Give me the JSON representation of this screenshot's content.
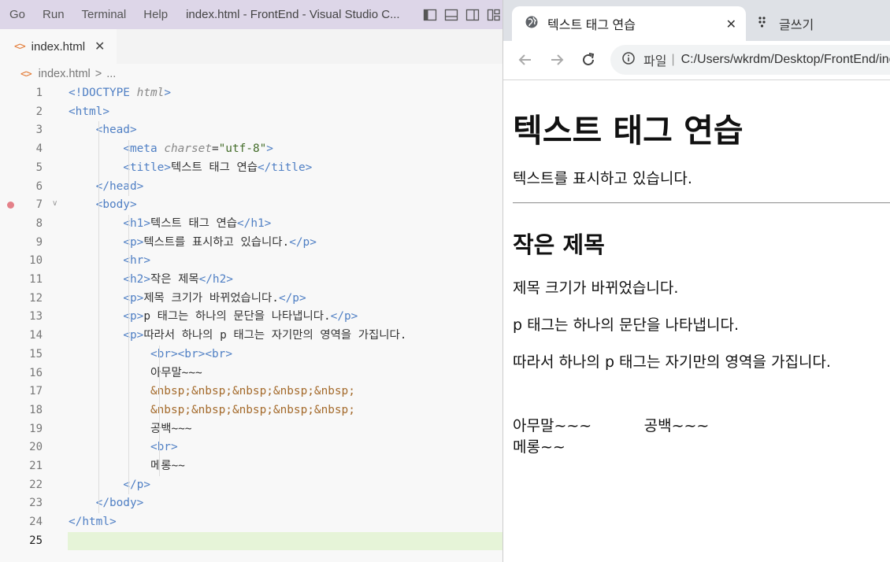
{
  "vscode": {
    "menu": [
      "Go",
      "Run",
      "Terminal",
      "Help"
    ],
    "window_title": "index.html - FrontEnd - Visual Studio C...",
    "tab": {
      "label": "index.html",
      "close": "✕"
    },
    "breadcrumb": {
      "file": "index.html",
      "sep": ">",
      "more": "..."
    },
    "current_line": 25,
    "code_lines": [
      "<!DOCTYPE html>",
      "<html>",
      "    <head>",
      "        <meta charset=\"utf-8\">",
      "        <title>텍스트 태그 연습</title>",
      "    </head>",
      "    <body>",
      "        <h1>텍스트 태그 연습</h1>",
      "        <p>텍스트를 표시하고 있습니다.</p>",
      "        <hr>",
      "        <h2>작은 제목</h2>",
      "        <p>제목 크기가 바뀌었습니다.</p>",
      "        <p>p 태그는 하나의 문단을 나타냅니다.</p>",
      "        <p>따라서 하나의 p 태그는 자기만의 영역을 가집니다.",
      "            <br><br><br>",
      "            아무말~~~",
      "            &nbsp;&nbsp;&nbsp;&nbsp;&nbsp;",
      "            &nbsp;&nbsp;&nbsp;&nbsp;&nbsp;",
      "            공백~~~",
      "            <br>",
      "            메롱~~",
      "        </p>",
      "    </body>",
      "</html>",
      ""
    ]
  },
  "browser": {
    "tab_title": "텍스트 태그 연습",
    "tab_close": "✕",
    "tab2_label": "글쓰기",
    "address_label": "파일",
    "address_sep": "|",
    "address_url": "C:/Users/wkrdm/Desktop/FrontEnd/index.html",
    "content": {
      "h1": "텍스트 태그 연습",
      "p1": "텍스트를 표시하고 있습니다.",
      "h2": "작은 제목",
      "p2": "제목 크기가 바뀌었습니다.",
      "p3": "p 태그는 하나의 문단을 나타냅니다.",
      "p4": "따라서 하나의 p 태그는 자기만의 영역을 가집니다.",
      "line1": "아무말~~~           공백~~~",
      "line2": "메롱~~"
    }
  }
}
